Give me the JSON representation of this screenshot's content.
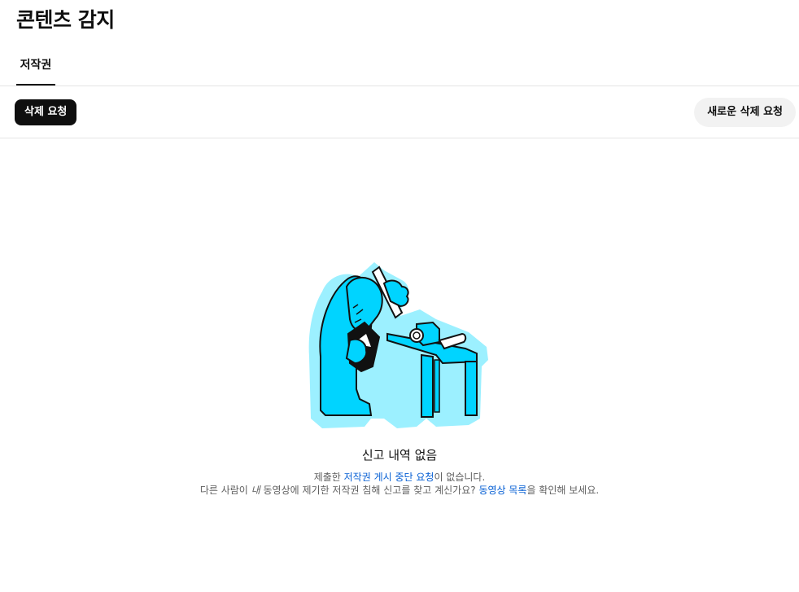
{
  "page": {
    "title": "콘텐츠 감지"
  },
  "tabs": [
    {
      "label": "저작권",
      "selected": true
    }
  ],
  "toolbar": {
    "filter_chip_label": "삭제 요청",
    "new_request_label": "새로운 삭제 요청"
  },
  "empty_state": {
    "illustration_icon": "person-inspecting-camera-with-magnifier-illustration",
    "title": "신고 내역 없음",
    "line1": {
      "prefix": "제출한 ",
      "link": "저작권 게시 중단 요청",
      "suffix": "이 없습니다."
    },
    "line2": {
      "prefix": "다른 사람이 ",
      "italic": "내",
      "middle": " 동영상에 제기한 저작권 침해 신고를 찾고 계신가요? ",
      "link": "동영상 목록",
      "suffix": "을 확인해 보세요."
    }
  },
  "colors": {
    "link": "#065fd4",
    "illustration_fill": "#00d4ff",
    "illustration_halo": "#9cf0ff",
    "chip_bg": "#0f0f0f",
    "button_bg": "#f2f2f2"
  }
}
